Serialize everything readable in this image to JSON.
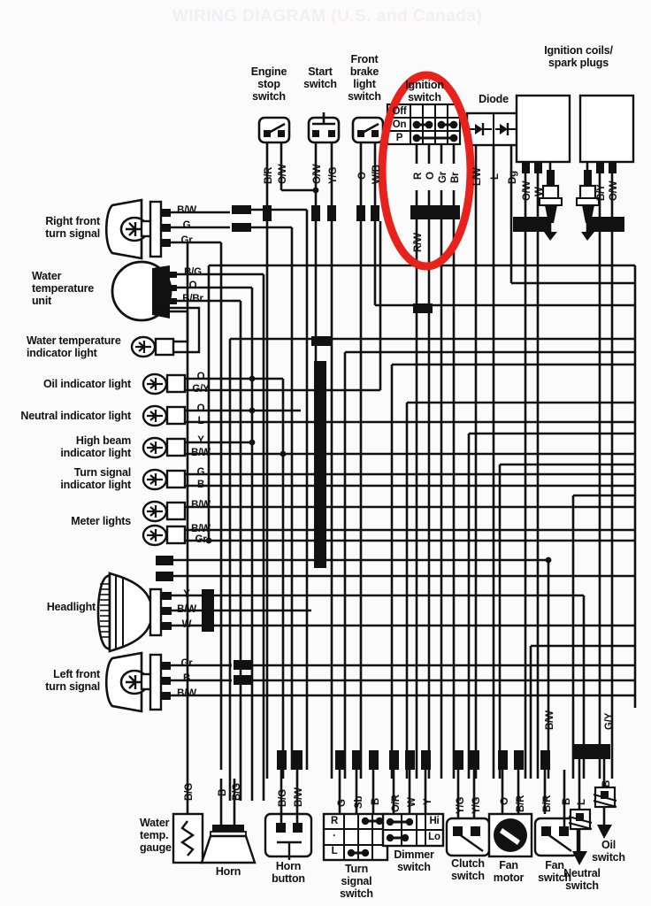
{
  "document": {
    "title": "WIRING DIAGRAM (U.S. and Canada)",
    "title_color": "#f3eff2",
    "background": "#fcfbfb",
    "ink": "#111111",
    "highlight_color": "#e8211c",
    "highlight_name": "ignition-switch-red-ellipse"
  },
  "top_components": {
    "engine_stop_switch": {
      "label": "Engine\nstop\nswitch",
      "wires": [
        "B/R",
        "O/W"
      ]
    },
    "start_switch": {
      "label": "Start\nswitch",
      "wires": [
        "O/W",
        "Y/G"
      ]
    },
    "front_brake_light_switch": {
      "label": "Front\nbrake\nlight\nswitch",
      "wires": [
        "O",
        "W/B"
      ]
    },
    "ignition_switch": {
      "label": "Ignition\nswitch",
      "rows": [
        "Off",
        "On",
        "P"
      ],
      "wires": [
        "R",
        "O",
        "Gr",
        "Br"
      ],
      "extra_wire": "R/W",
      "continuity": {
        "Off": [],
        "On": [
          [
            "R",
            "O"
          ],
          [
            "Gr",
            "Br"
          ]
        ],
        "P": [
          [
            "R",
            "Br"
          ]
        ]
      }
    },
    "diode": {
      "label": "Diode",
      "wires": [
        "L/W",
        "L",
        "Dg"
      ]
    },
    "ignition_coils": {
      "label": "Ignition coils/\nspark plugs",
      "coil1_wires": [
        "O/W",
        "W"
      ],
      "coil2_wires": [
        "B/Y",
        "O/W"
      ]
    }
  },
  "left_components": [
    {
      "name": "right-front-turn-signal",
      "label": "Right front\nturn signal",
      "wires": [
        "B/W",
        "G",
        "Gr"
      ],
      "icon": "turn-signal-lamp"
    },
    {
      "name": "water-temperature-unit",
      "label": "Water\ntemperature\nunit",
      "wires": [
        "B/G",
        "O",
        "B/Br"
      ],
      "icon": "sender-bulb"
    },
    {
      "name": "water-temperature-indicator-light",
      "label": "Water temperature\nindicator light",
      "wires": [],
      "icon": "indicator-lamp"
    },
    {
      "name": "oil-indicator-light",
      "label": "Oil indicator light",
      "wires": [
        "O",
        "G/Y"
      ],
      "icon": "indicator-lamp"
    },
    {
      "name": "neutral-indicator-light",
      "label": "Neutral indicator light",
      "wires": [
        "O",
        "L"
      ],
      "icon": "indicator-lamp"
    },
    {
      "name": "high-beam-indicator-light",
      "label": "High beam\nindicator light",
      "wires": [
        "Y",
        "B/W"
      ],
      "icon": "indicator-lamp"
    },
    {
      "name": "turn-signal-indicator-light",
      "label": "Turn signal\nindicator light",
      "wires": [
        "G",
        "B"
      ],
      "icon": "indicator-lamp"
    },
    {
      "name": "meter-lights",
      "label": "Meter lights",
      "wires": [
        "B/W",
        "B/W",
        "Gr"
      ],
      "icon": "indicator-lamp"
    },
    {
      "name": "headlight",
      "label": "Headlight",
      "wires": [
        "Y",
        "B/W",
        "W"
      ],
      "icon": "headlight-lamp"
    },
    {
      "name": "left-front-turn-signal",
      "label": "Left front\nturn signal",
      "wires": [
        "Gr",
        "B",
        "B/W"
      ],
      "icon": "turn-signal-lamp"
    }
  ],
  "bottom_components": [
    {
      "name": "water-temp-gauge",
      "label": "Water\ntemp.\ngauge",
      "wires": [
        "B/G"
      ],
      "icon": "resistor"
    },
    {
      "name": "horn",
      "label": "Horn",
      "wires": [
        "B",
        "B/G"
      ],
      "icon": "horn"
    },
    {
      "name": "horn-button",
      "label": "Horn\nbutton",
      "wires": [
        "B/G",
        "B/W"
      ],
      "icon": "push-button"
    },
    {
      "name": "turn-signal-switch",
      "label": "Turn\nsignal\nswitch",
      "wires": [
        "G",
        "Sb",
        "B"
      ],
      "rows": [
        "R",
        "·",
        "L"
      ],
      "icon": "switch-table"
    },
    {
      "name": "dimmer-switch",
      "label": "Dimmer\nswitch",
      "wires": [
        "O/R",
        "W",
        "Y"
      ],
      "rows": [
        "Hi",
        "Lo"
      ],
      "icon": "switch-table"
    },
    {
      "name": "clutch-switch",
      "label": "Clutch\nswitch",
      "wires": [
        "Y/G",
        "Y/G"
      ],
      "icon": "lever-switch"
    },
    {
      "name": "fan-motor",
      "label": "Fan\nmotor",
      "wires": [
        "O",
        "B/R"
      ],
      "icon": "motor"
    },
    {
      "name": "fan-switch",
      "label": "Fan\nswitch",
      "wires": [
        "B/R",
        "B"
      ],
      "icon": "lever-switch"
    },
    {
      "name": "neutral-switch",
      "label": "Neutral\nswitch",
      "wires": [
        "L"
      ],
      "icon": "ground-spring"
    },
    {
      "name": "oil-switch",
      "label": "Oil\nswitch",
      "wires": [
        "B"
      ],
      "icon": "ground-spring"
    }
  ],
  "right_vertical_wires": [
    "B/W",
    "G/Y"
  ]
}
